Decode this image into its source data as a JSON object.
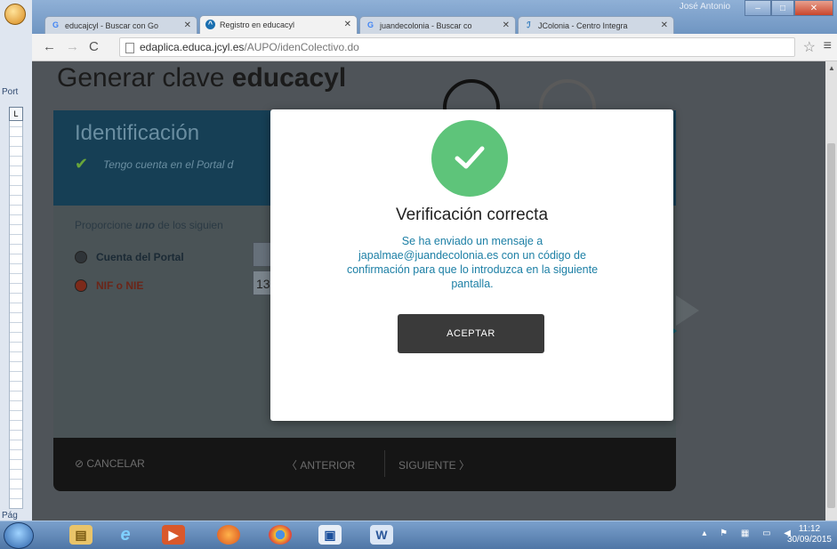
{
  "word": {
    "side_label": "Port",
    "page_label": "Pág"
  },
  "browser": {
    "tabs": [
      {
        "label": "educajcyl - Buscar con Go",
        "favicon": "google-icon"
      },
      {
        "label": "Registro en educacyl",
        "favicon": "educacyl-icon"
      },
      {
        "label": "juandecolonia - Buscar co",
        "favicon": "google-icon"
      },
      {
        "label": "JColonia - Centro Integra",
        "favicon": "jcolonia-icon"
      }
    ],
    "user_label": "José Antonio",
    "url_host": "edaplica.educa.jcyl.es",
    "url_path": "/AUPO/idenColectivo.do"
  },
  "page": {
    "title_prefix": "Generar clave ",
    "title_bold": "educacyl",
    "section_title": "Identificación",
    "has_account_text": "Tengo cuenta en el Portal d",
    "provide_prefix": "Proporcione ",
    "provide_em": "uno",
    "provide_suffix": " de los siguien",
    "options": [
      {
        "label": "Cuenta del Portal",
        "selected": false
      },
      {
        "label": "NIF o NIE",
        "selected": true
      }
    ],
    "nif_value_partial": "13",
    "footer": {
      "cancel": "CANCELAR",
      "previous": "ANTERIOR",
      "next": "SIGUIENTE"
    }
  },
  "modal": {
    "title": "Verificación correcta",
    "message": "Se ha enviado un mensaje a japalmae@juandecolonia.es con un código de confirmación para que lo introduzca en la siguiente pantalla.",
    "accept_label": "ACEPTAR",
    "success_color": "#5ec47a"
  },
  "taskbar": {
    "time": "11:12",
    "date": "30/09/2015"
  }
}
